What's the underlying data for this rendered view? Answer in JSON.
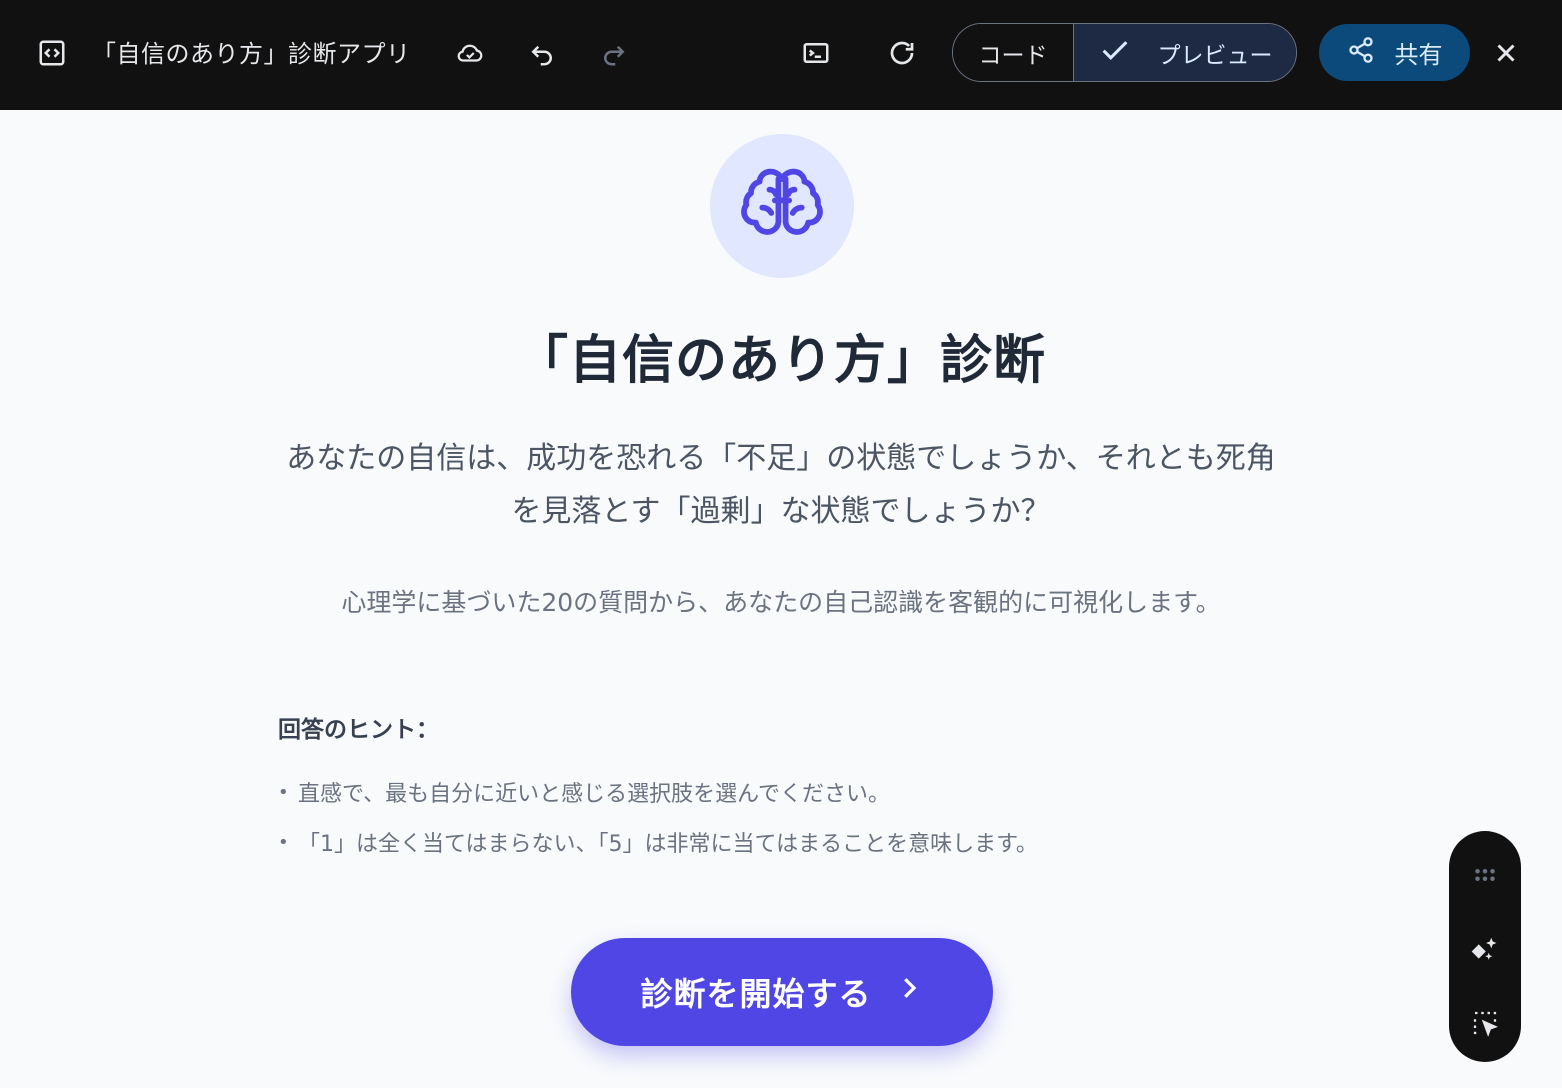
{
  "topbar": {
    "app_title": "「自信のあり方」診断アプリ",
    "code_label": "コード",
    "preview_label": "プレビュー",
    "share_label": "共有"
  },
  "hero": {
    "title": "「自信のあり方」診断",
    "lead_line1": "あなたの自信は、成功を恐れる「不足」の状態でしょうか、それとも死角",
    "lead_line2": "を見落とす「過剰」な状態でしょうか？",
    "sub": "心理学に基づいた20の質問から、あなたの自己認識を客観的に可視化します。"
  },
  "hints": {
    "title": "回答のヒント：",
    "items": [
      "直感で、最も自分に近いと感じる選択肢を選んでください。",
      "「1」は全く当てはまらない、「5」は非常に当てはまることを意味します。"
    ]
  },
  "start_button": {
    "label": "診断を開始する"
  },
  "colors": {
    "accent": "#4f46e5",
    "topbar_bg": "#111111",
    "share_bg": "#0b4a7a",
    "page_bg": "#f8fafc"
  },
  "icons": {
    "topbar": [
      "code-frame-icon",
      "cloud-check-icon",
      "undo-icon",
      "redo-icon",
      "terminal-icon",
      "refresh-icon",
      "check-icon",
      "share-icon",
      "close-icon"
    ],
    "hero": "brain-icon",
    "start": "chevron-right-icon",
    "floating": [
      "drag-grip-icon",
      "sparkle-edit-icon",
      "select-element-icon"
    ]
  }
}
